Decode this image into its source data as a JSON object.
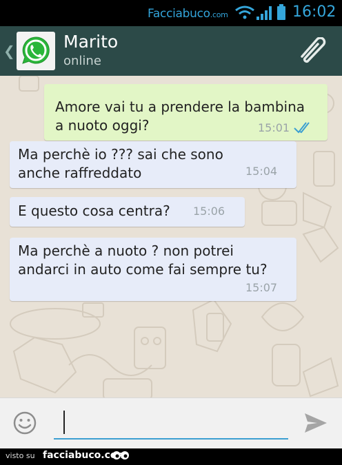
{
  "status_bar": {
    "brand": "Facciabuco",
    "brand_domain": ".com",
    "time": "16:02",
    "wifi_icon": "wifi-icon",
    "signal_icon": "signal-icon",
    "battery_icon": "battery-icon",
    "color": "#35a6db"
  },
  "header": {
    "contact_name": "Marito",
    "contact_status": "online",
    "back_icon": "chevron-left-icon",
    "avatar_icon": "whatsapp-logo",
    "attach_icon": "paperclip-icon",
    "background": "#2c4a48"
  },
  "messages": [
    {
      "direction": "outgoing",
      "text": "Amore vai tu a prendere la bambina\na nuoto oggi?",
      "time": "15:01",
      "status_icon": "double-check-icon"
    },
    {
      "direction": "incoming",
      "text": "Ma perchè io ??? sai che sono\nanche raffreddato",
      "time": "15:04"
    },
    {
      "direction": "incoming",
      "text": "E questo cosa centra?",
      "time": "15:06"
    },
    {
      "direction": "incoming",
      "text": "Ma perchè a nuoto ? non potrei\nandarci in auto come fai sempre tu?",
      "time": "15:07"
    }
  ],
  "colors": {
    "outgoing_bubble": "#e2f6c6",
    "incoming_bubble": "#e7ecf9",
    "chat_background": "#e8e1d6",
    "read_ticks": "#3b9fd1"
  },
  "input_bar": {
    "value": "",
    "emoji_icon": "smiley-icon",
    "send_icon": "send-icon"
  },
  "footer": {
    "visto_su": "visto su",
    "brand": "facciabuco.com",
    "eyes_icon": "eyes-icon"
  }
}
